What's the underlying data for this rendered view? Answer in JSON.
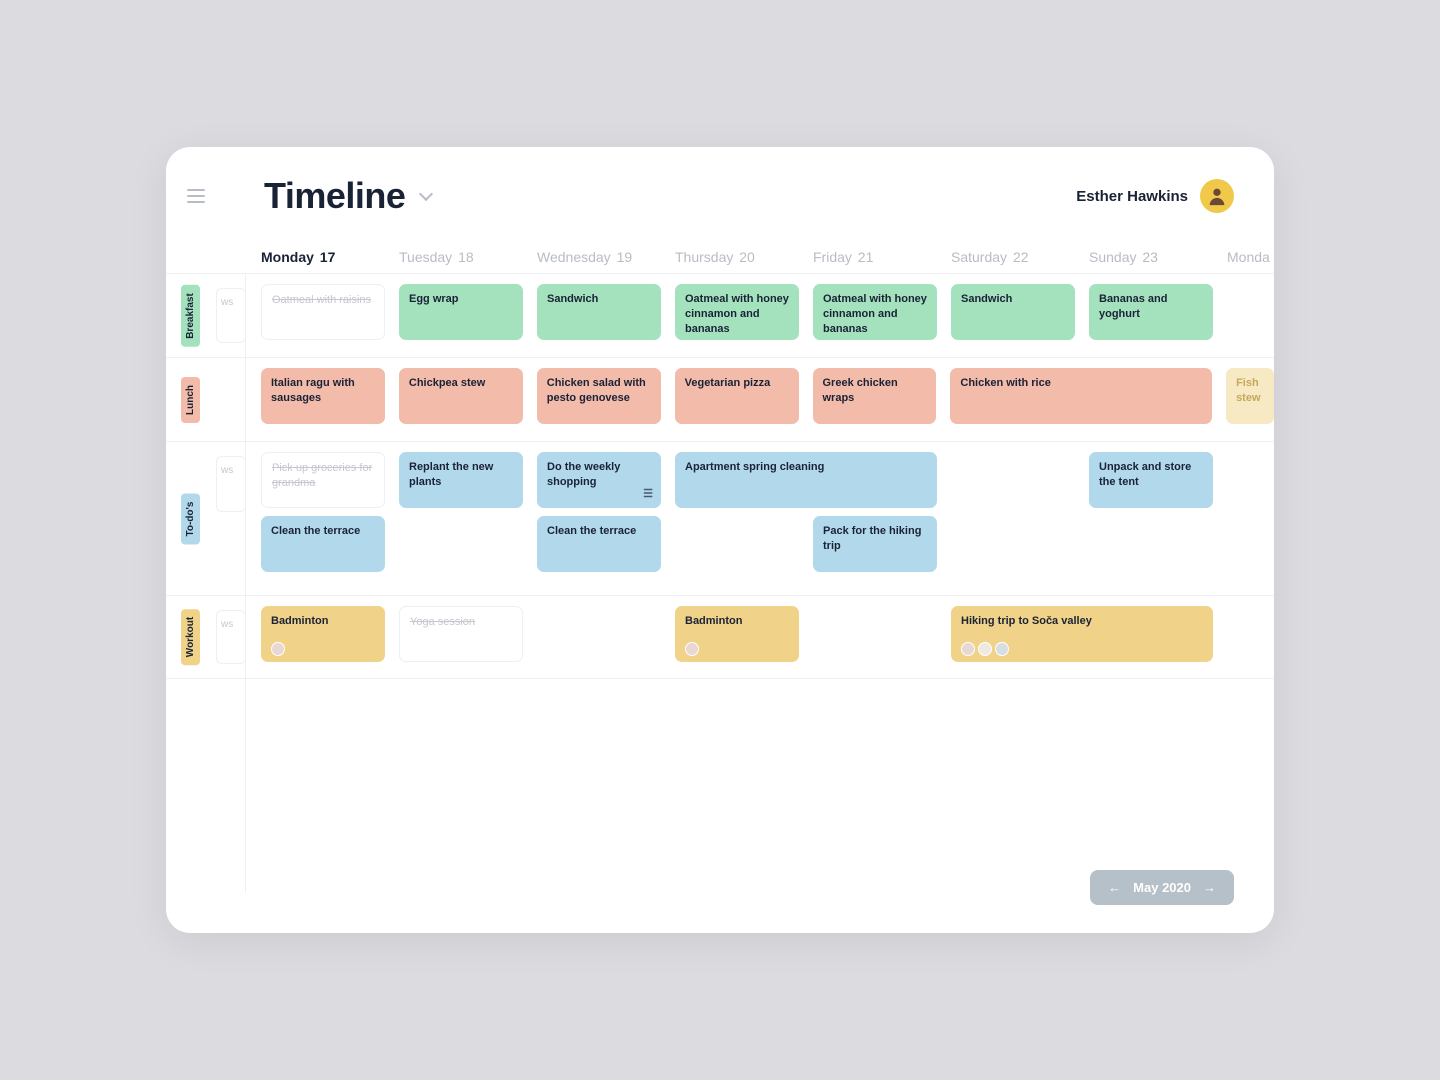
{
  "header": {
    "title": "Timeline",
    "user_name": "Esther Hawkins"
  },
  "days": [
    {
      "name": "Monday",
      "num": "17",
      "active": true
    },
    {
      "name": "Tuesday",
      "num": "18",
      "active": false
    },
    {
      "name": "Wednesday",
      "num": "19",
      "active": false
    },
    {
      "name": "Thursday",
      "num": "20",
      "active": false
    },
    {
      "name": "Friday",
      "num": "21",
      "active": false
    },
    {
      "name": "Saturday",
      "num": "22",
      "active": false
    },
    {
      "name": "Sunday",
      "num": "23",
      "active": false
    },
    {
      "name": "Monda",
      "num": "",
      "active": false
    }
  ],
  "categories": {
    "breakfast": "Breakfast",
    "lunch": "Lunch",
    "todos": "To-do's",
    "workout": "Workout"
  },
  "peek_text": "ws",
  "cards": {
    "bf_mon": "Oatmeal with raisins",
    "bf_tue": "Egg wrap",
    "bf_wed": "Sandwich",
    "bf_thu": "Oatmeal with honey cinnamon and bananas",
    "bf_fri": "Oatmeal with honey cinnamon and bananas",
    "bf_sat": "Sandwich",
    "bf_sun": "Bananas and yoghurt",
    "lu_mon": "Italian ragu with sausages",
    "lu_tue": "Chickpea stew",
    "lu_wed": "Chicken salad with pesto genovese",
    "lu_thu": "Vegetarian pizza",
    "lu_fri": "Greek chicken wraps",
    "lu_sat": "Chicken with rice",
    "lu_next": "Fish stew",
    "td_mon1": "Pick up groceries for grandma",
    "td_tue1": "Replant the new plants",
    "td_wed1": "Do the weekly shopping",
    "td_thu1": "Apartment spring cleaning",
    "td_sun1": "Unpack and store the tent",
    "td_mon2": "Clean the terrace",
    "td_wed2": "Clean the terrace",
    "td_fri2": "Pack for the hiking trip",
    "wo_mon": "Badminton",
    "wo_tue": "Yoga session",
    "wo_thu": "Badminton",
    "wo_sat": "Hiking trip to Soča valley"
  },
  "month_nav": {
    "label": "May 2020",
    "prev": "←",
    "next": "→"
  },
  "colors": {
    "green": "#a4e2bd",
    "pink": "#f3bba9",
    "blue": "#b2d9eb",
    "yellow": "#f0d288"
  }
}
